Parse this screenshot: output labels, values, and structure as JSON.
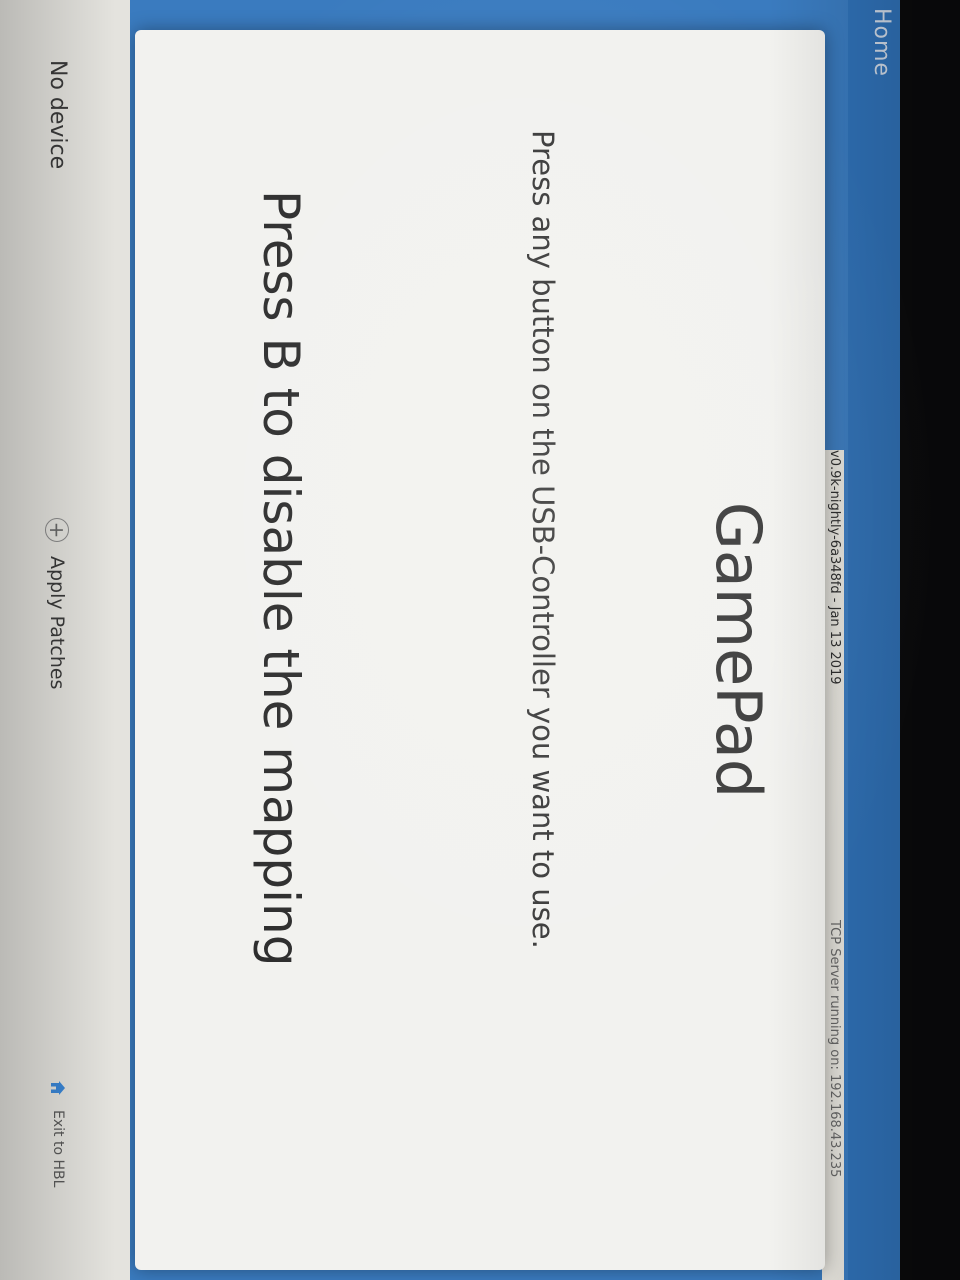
{
  "header": {
    "home_label": "Home"
  },
  "status": {
    "version": "v0.9k-nightly-6a348fd - Jan 13 2019",
    "tcp_server": "TCP Server running on: 192.168.43.235"
  },
  "dialog": {
    "title": "GamePad",
    "message": "Press any button on the USB-Controller you want to use.",
    "hint": "Press B to disable the mapping"
  },
  "footer": {
    "device_status": "No device",
    "apply_patches_label": "Apply Patches",
    "exit_label": "Exit to HBL",
    "plus_icon_glyph": "+"
  },
  "colors": {
    "top_bar": "#2f71b7",
    "dialog_bg": "#f2f2ef",
    "footer_bg": "#e4e3de"
  }
}
